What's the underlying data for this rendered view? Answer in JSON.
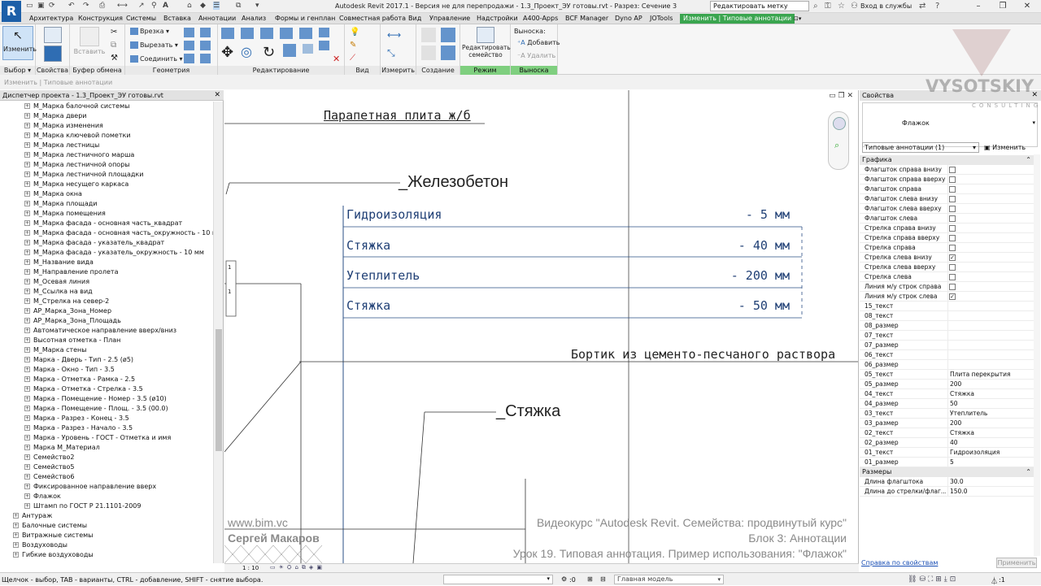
{
  "app": {
    "icon_letter": "R",
    "title": "Autodesk Revit 2017.1 - Версия не для перепродажи -   1.3_Проект_ЭУ готовы.rvt - Разрез: Сечение 3",
    "search_value": "Редактировать метку",
    "login": "Вход в службы"
  },
  "tabs": [
    "Архитектура",
    "Конструкция",
    "Системы",
    "Вставка",
    "Аннотации",
    "Анализ",
    "Формы и генплан",
    "Совместная работа",
    "Вид",
    "Управление",
    "Надстройки",
    "A400-Apps",
    "BCF Manager",
    "Dyno AP",
    "JOTools",
    "Изменить | Типовые аннотации"
  ],
  "ribbon": {
    "modify_label": "Изменить",
    "panels": {
      "select": "Выбор",
      "properties": "Свойства",
      "clipboard": "Буфер обмена",
      "geometry": "Геометрия",
      "modify": "Редактирование",
      "view": "Вид",
      "measure": "Измерить",
      "create": "Создание",
      "mode": "Режим",
      "leader": "Выноска"
    },
    "paste": "Вставить",
    "cut": "Врезка",
    "cutout": "Вырезать",
    "join": "Соединить",
    "edit_family": "Редактировать семейство",
    "leader_title": "Выноска:",
    "add": "Добавить",
    "remove": "Удалить"
  },
  "context_label": "Изменить | Типовые аннотации",
  "watermark": {
    "name": "VYSOTSKIY",
    "sub": "CONSULTING"
  },
  "browser": {
    "title": "Диспетчер проекта - 1.3_Проект_ЭУ готовы.rvt",
    "items": [
      {
        "label": "M_Марка балочной системы",
        "level": 2
      },
      {
        "label": "M_Марка двери",
        "level": 2
      },
      {
        "label": "M_Марка изменения",
        "level": 2
      },
      {
        "label": "M_Марка ключевой пометки",
        "level": 2
      },
      {
        "label": "M_Марка лестницы",
        "level": 2
      },
      {
        "label": "M_Марка лестничного марша",
        "level": 2
      },
      {
        "label": "M_Марка лестничной опоры",
        "level": 2
      },
      {
        "label": "M_Марка лестничной площадки",
        "level": 2
      },
      {
        "label": "M_Марка несущего каркаса",
        "level": 2
      },
      {
        "label": "M_Марка окна",
        "level": 2
      },
      {
        "label": "M_Марка площади",
        "level": 2
      },
      {
        "label": "M_Марка помещения",
        "level": 2
      },
      {
        "label": "M_Марка фасада - основная часть_квадрат",
        "level": 2
      },
      {
        "label": "M_Марка фасада - основная часть_окружность - 10 мм",
        "level": 2
      },
      {
        "label": "M_Марка фасада - указатель_квадрат",
        "level": 2
      },
      {
        "label": "M_Марка фасада - указатель_окружность - 10 мм",
        "level": 2
      },
      {
        "label": "M_Название вида",
        "level": 2
      },
      {
        "label": "M_Направление пролета",
        "level": 2
      },
      {
        "label": "M_Осевая линия",
        "level": 2
      },
      {
        "label": "M_Ссылка на вид",
        "level": 2
      },
      {
        "label": "M_Стрелка на север-2",
        "level": 2
      },
      {
        "label": "АР_Марка_Зона_Номер",
        "level": 2
      },
      {
        "label": "АР_Марка_Зона_Площадь",
        "level": 2
      },
      {
        "label": "Автоматическое направление вверх/вниз",
        "level": 2
      },
      {
        "label": "Высотная отметка - План",
        "level": 2
      },
      {
        "label": "M_Марка стены",
        "level": 2
      },
      {
        "label": "Марка - Дверь - Тип - 2.5 (ø5)",
        "level": 2
      },
      {
        "label": "Марка - Окно - Тип - 3.5",
        "level": 2
      },
      {
        "label": "Марка - Отметка - Рамка - 2.5",
        "level": 2
      },
      {
        "label": "Марка - Отметка - Стрелка - 3.5",
        "level": 2
      },
      {
        "label": "Марка - Помещение - Номер - 3.5 (ø10)",
        "level": 2
      },
      {
        "label": "Марка - Помещение - Площ. - 3.5 (00.0)",
        "level": 2
      },
      {
        "label": "Марка - Разрез - Конец - 3.5",
        "level": 2
      },
      {
        "label": "Марка - Разрез - Начало - 3.5",
        "level": 2
      },
      {
        "label": "Марка - Уровень - ГОСТ - Отметка и имя",
        "level": 2
      },
      {
        "label": "Марка M_Материал",
        "level": 2
      },
      {
        "label": "Семейство2",
        "level": 2
      },
      {
        "label": "Семейство5",
        "level": 2
      },
      {
        "label": "Семейство6",
        "level": 2
      },
      {
        "label": "Фиксированное направление вверх",
        "level": 2
      },
      {
        "label": "Флажок",
        "level": 2
      },
      {
        "label": "Штамп по ГОСТ Р 21.1101-2009",
        "level": 2
      },
      {
        "label": "Антураж",
        "level": 1
      },
      {
        "label": "Балочные системы",
        "level": 1
      },
      {
        "label": "Витражные системы",
        "level": 1
      },
      {
        "label": "Воздуховоды",
        "level": 1
      },
      {
        "label": "Гибкие воздуховоды",
        "level": 1
      }
    ]
  },
  "drawing": {
    "label_top": "Парапетная плита ж/б",
    "label_concrete": "_Железобетон",
    "layers": [
      {
        "name": "Гидроизоляция",
        "size": "- 5 мм"
      },
      {
        "name": "Стяжка",
        "size": "- 40 мм"
      },
      {
        "name": "Утеплитель",
        "size": "- 200 мм"
      },
      {
        "name": "Стяжка",
        "size": "- 50 мм"
      }
    ],
    "label_curb": "Бортик из цементо-песчаного раствора",
    "label_screed": "_Стяжка",
    "side_tag_a": "1",
    "side_tag_b": "1"
  },
  "credits": {
    "site": "www.bim.vc",
    "author": "Сергей Макаров",
    "course": "Видеокурс \"Autodesk Revit. Семейства: продвинутый курс\"",
    "block": "Блок 3: Аннотации",
    "lesson": "Урок 19. Типовая аннотация. Пример использования: \"Флажок\""
  },
  "viewbar": {
    "scale": "1 : 10"
  },
  "properties": {
    "title": "Свойства",
    "type_name": "Флажок",
    "filter": "Типовые аннотации (1)",
    "edit_type": "Изменить тип",
    "section_graphics": "Графика",
    "checkbox_rows": [
      {
        "name": "Флагшток справа внизу",
        "checked": false
      },
      {
        "name": "Флагшток справа вверху",
        "checked": false
      },
      {
        "name": "Флагшток справа",
        "checked": false
      },
      {
        "name": "Флагшток слева внизу",
        "checked": false
      },
      {
        "name": "Флагшток слева вверху",
        "checked": false
      },
      {
        "name": "Флагшток слева",
        "checked": false
      },
      {
        "name": "Стрелка справа внизу",
        "checked": false
      },
      {
        "name": "Стрелка справа вверху",
        "checked": false
      },
      {
        "name": "Стрелка справа",
        "checked": false
      },
      {
        "name": "Стрелка слева внизу",
        "checked": true
      },
      {
        "name": "Стрелка слева вверху",
        "checked": false
      },
      {
        "name": "Стрелка слева",
        "checked": false
      },
      {
        "name": "Линия м/у строк справа",
        "checked": false
      },
      {
        "name": "Линия м/у строк слева",
        "checked": true
      }
    ],
    "value_rows": [
      {
        "name": "15_текст",
        "value": ""
      },
      {
        "name": "08_текст",
        "value": ""
      },
      {
        "name": "08_размер",
        "value": ""
      },
      {
        "name": "07_текст",
        "value": ""
      },
      {
        "name": "07_размер",
        "value": ""
      },
      {
        "name": "06_текст",
        "value": ""
      },
      {
        "name": "06_размер",
        "value": ""
      },
      {
        "name": "05_текст",
        "value": "Плита перекрытия"
      },
      {
        "name": "05_размер",
        "value": "200"
      },
      {
        "name": "04_текст",
        "value": "Стяжка"
      },
      {
        "name": "04_размер",
        "value": "50"
      },
      {
        "name": "03_текст",
        "value": "Утеплитель"
      },
      {
        "name": "03_размер",
        "value": "200"
      },
      {
        "name": "02_текст",
        "value": "Стяжка"
      },
      {
        "name": "02_размер",
        "value": "40"
      },
      {
        "name": "01_текст",
        "value": "Гидроизоляция"
      },
      {
        "name": "01_размер",
        "value": "5"
      }
    ],
    "section_dims": "Размеры",
    "dim_rows": [
      {
        "name": "Длина флагштока",
        "value": "30.0"
      },
      {
        "name": "Длина до стрелки/флаг...",
        "value": "150.0"
      }
    ],
    "help": "Справка по свойствам",
    "apply": "Применить"
  },
  "status": {
    "text": "Щелчок - выбор, TAB - варианты, CTRL - добавление, SHIFT - снятие выбора.",
    "model": "Главная модель",
    "zero": ":0",
    "filter_count": ":1"
  }
}
